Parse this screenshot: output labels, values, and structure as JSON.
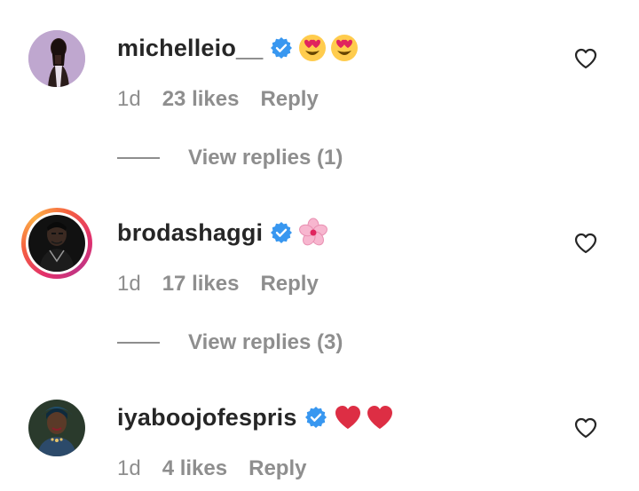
{
  "comments": [
    {
      "username": "michelleio__",
      "verified": true,
      "emoji_text": "😍😍",
      "time": "1d",
      "likes": "23 likes",
      "reply_label": "Reply",
      "view_replies": "View replies (1)",
      "liked": false
    },
    {
      "username": "brodashaggi",
      "verified": true,
      "emoji_text": "🌸",
      "time": "1d",
      "likes": "17 likes",
      "reply_label": "Reply",
      "view_replies": "View replies (3)",
      "liked": false,
      "has_story_ring": true
    },
    {
      "username": "iyaboojofespris",
      "verified": true,
      "emoji_text": "❤️❤️",
      "time": "1d",
      "likes": "4 likes",
      "reply_label": "Reply",
      "liked": false
    }
  ],
  "icons": {
    "verified": "verified-badge-icon",
    "like": "heart-outline-icon"
  },
  "colors": {
    "text_primary": "#262626",
    "text_secondary": "#8e8e8e",
    "verified_blue": "#3897f0",
    "heart_red": "#ed4956"
  }
}
